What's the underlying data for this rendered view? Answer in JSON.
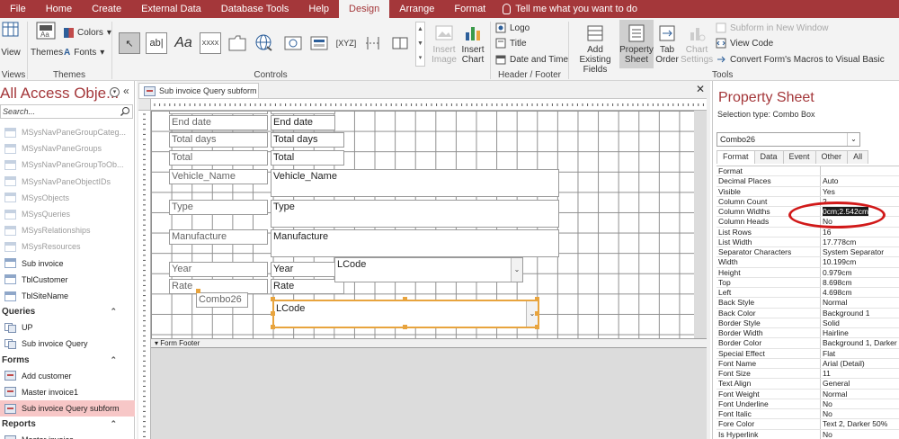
{
  "ribbon_tabs": [
    "File",
    "Home",
    "Create",
    "External Data",
    "Database Tools",
    "Help",
    "Design",
    "Arrange",
    "Format"
  ],
  "active_tab": "Design",
  "tell_me": "Tell me what you want to do",
  "ribbon": {
    "views": {
      "view_label": "View",
      "group_label": "Views"
    },
    "themes": {
      "themes_label": "Themes",
      "colors_label": "Colors",
      "fonts_label": "Fonts",
      "group_label": "Themes"
    },
    "controls": {
      "group_label": "Controls",
      "tools": [
        "select",
        "ab|",
        "Aa",
        "xxxx",
        "tab",
        "web",
        "nav",
        "XYZ",
        "line",
        "toggle"
      ]
    },
    "insert_image": "Insert Image",
    "insert_chart": "Insert Chart",
    "header_footer": {
      "logo": "Logo",
      "title": "Title",
      "date_time": "Date and Time",
      "group_label": "Header / Footer"
    },
    "tools": {
      "add_existing_fields": "Add Existing Fields",
      "property_sheet": "Property Sheet",
      "tab_order": "Tab Order",
      "chart_settings": "Chart Settings",
      "subform_new_window": "Subform in New Window",
      "view_code": "View Code",
      "convert_macros": "Convert Form's Macros to Visual Basic",
      "group_label": "Tools"
    }
  },
  "nav": {
    "title": "All Access Obje...",
    "search_placeholder": "Search...",
    "tables": [
      "MSysNavPaneGroupCateg...",
      "MSysNavPaneGroups",
      "MSysNavPaneGroupToOb...",
      "MSysNavPaneObjectIDs",
      "MSysObjects",
      "MSysQueries",
      "MSysRelationships",
      "MSysResources",
      "Sub invoice",
      "TblCustomer",
      "TblSiteName"
    ],
    "groups": {
      "queries": {
        "label": "Queries",
        "items": [
          "UP",
          "Sub invoice Query"
        ]
      },
      "forms": {
        "label": "Forms",
        "items": [
          "Add customer",
          "Master invoice1",
          "Sub invoice Query subform"
        ]
      },
      "reports": {
        "label": "Reports",
        "items": [
          "Master invoice"
        ]
      }
    }
  },
  "doc": {
    "tab_title": "Sub invoice Query subform",
    "form_footer": "Form Footer",
    "labels": [
      "End date",
      "Total days",
      "Total",
      "Vehicle_Name",
      "Type",
      "Manufacture",
      "Year",
      "Rate",
      "Combo26"
    ],
    "fields": [
      "End date",
      "Total days",
      "Total",
      "Vehicle_Name",
      "Type",
      "Manufacture",
      "Year",
      "Rate"
    ],
    "combo_lcode_1": "LCode",
    "combo_lcode_2": "LCode"
  },
  "property_sheet": {
    "title": "Property Sheet",
    "selection_type": "Selection type:  Combo Box",
    "selected_control": "Combo26",
    "tabs": [
      "Format",
      "Data",
      "Event",
      "Other",
      "All"
    ],
    "active_tab": "Format",
    "rows": [
      [
        "Format",
        ""
      ],
      [
        "Decimal Places",
        "Auto"
      ],
      [
        "Visible",
        "Yes"
      ],
      [
        "Column Count",
        "2"
      ],
      [
        "Column Widths",
        "0cm;2.542cm"
      ],
      [
        "Column Heads",
        "No"
      ],
      [
        "List Rows",
        "16"
      ],
      [
        "List Width",
        "17.778cm"
      ],
      [
        "Separator Characters",
        "System Separator"
      ],
      [
        "Width",
        "10.199cm"
      ],
      [
        "Height",
        "0.979cm"
      ],
      [
        "Top",
        "8.698cm"
      ],
      [
        "Left",
        "4.698cm"
      ],
      [
        "Back Style",
        "Normal"
      ],
      [
        "Back Color",
        "Background 1"
      ],
      [
        "Border Style",
        "Solid"
      ],
      [
        "Border Width",
        "Hairline"
      ],
      [
        "Border Color",
        "Background 1, Darker"
      ],
      [
        "Special Effect",
        "Flat"
      ],
      [
        "Font Name",
        "Arial (Detail)"
      ],
      [
        "Font Size",
        "11"
      ],
      [
        "Text Align",
        "General"
      ],
      [
        "Font Weight",
        "Normal"
      ],
      [
        "Font Underline",
        "No"
      ],
      [
        "Font Italic",
        "No"
      ],
      [
        "Fore Color",
        "Text 2, Darker 50%"
      ],
      [
        "Is Hyperlink",
        "No"
      ]
    ],
    "highlighted_row": "Column Widths"
  },
  "colors": {
    "accent": "#a4373a",
    "selection": "#e8a43e",
    "highlight_oval": "#d11919"
  }
}
